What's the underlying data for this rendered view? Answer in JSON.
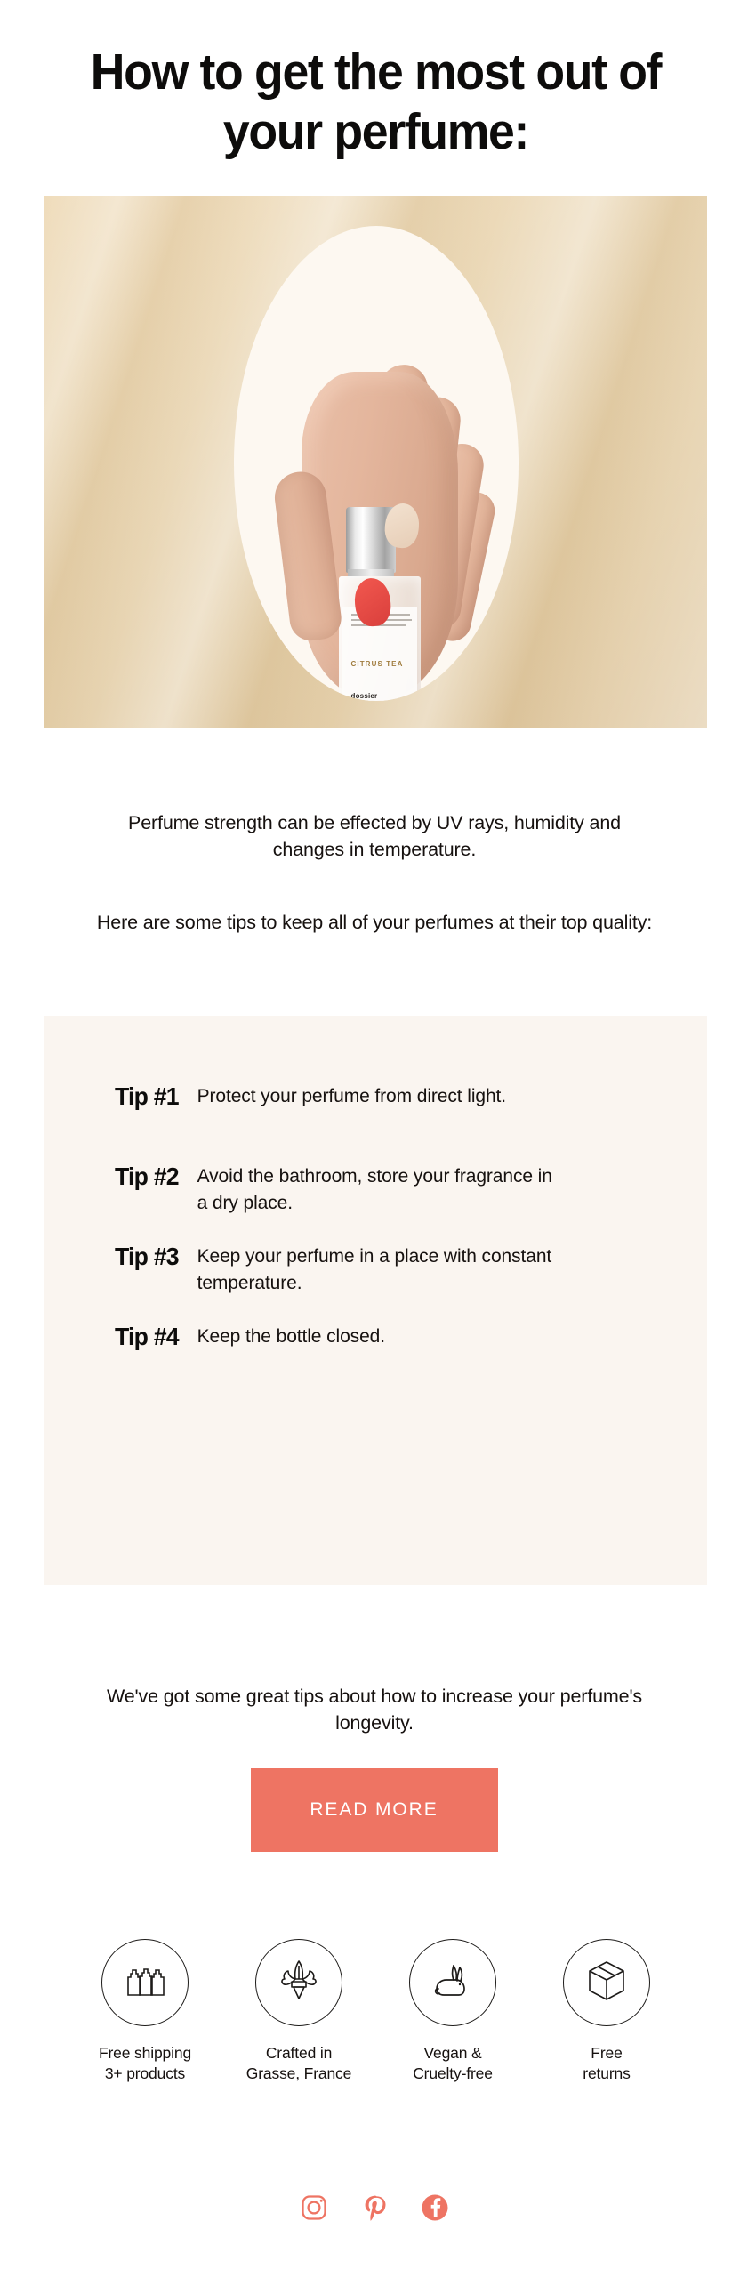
{
  "headline": "How to get the most out of your perfume:",
  "hero": {
    "alt_name": "hand-holding-perfume-bottle",
    "bottle_name": "CITRUS TEA",
    "bottle_brand": "dossier"
  },
  "intro": {
    "paragraph_1": "Perfume strength can be effected by UV rays, humidity and changes in temperature.",
    "paragraph_2": "Here are some tips to keep all of your perfumes at their top quality:"
  },
  "tips": [
    {
      "label": "Tip #1",
      "text": "Protect your perfume from direct light."
    },
    {
      "label": "Tip #2",
      "text": "Avoid the bathroom, store your fragrance in a dry place."
    },
    {
      "label": "Tip #3",
      "text": "Keep your perfume in a place with constant temperature."
    },
    {
      "label": "Tip #4",
      "text": "Keep the bottle closed."
    }
  ],
  "outro": "We've got some great tips about how to increase your perfume's longevity.",
  "cta": {
    "label": "READ MORE",
    "color": "#ee7463",
    "text_color": "#ffffff"
  },
  "features": [
    {
      "icon": "three-bottles-icon",
      "label": "Free shipping\n3+ products"
    },
    {
      "icon": "fleur-de-lis-icon",
      "label": "Crafted in\nGrasse, France"
    },
    {
      "icon": "rabbit-icon",
      "label": "Vegan &\nCruelty-free"
    },
    {
      "icon": "box-icon",
      "label": "Free\nreturns"
    }
  ],
  "social": {
    "color": "#ee7463",
    "items": [
      {
        "icon": "instagram-icon",
        "name": "Instagram"
      },
      {
        "icon": "pinterest-icon",
        "name": "Pinterest"
      },
      {
        "icon": "facebook-icon",
        "name": "Facebook"
      }
    ]
  },
  "colors": {
    "accent": "#ee7463",
    "tips_panel_bg": "#faf5f0",
    "hero_bg": "#e8d4b0",
    "page_bg": "#ffffff",
    "text": "#16110f"
  }
}
